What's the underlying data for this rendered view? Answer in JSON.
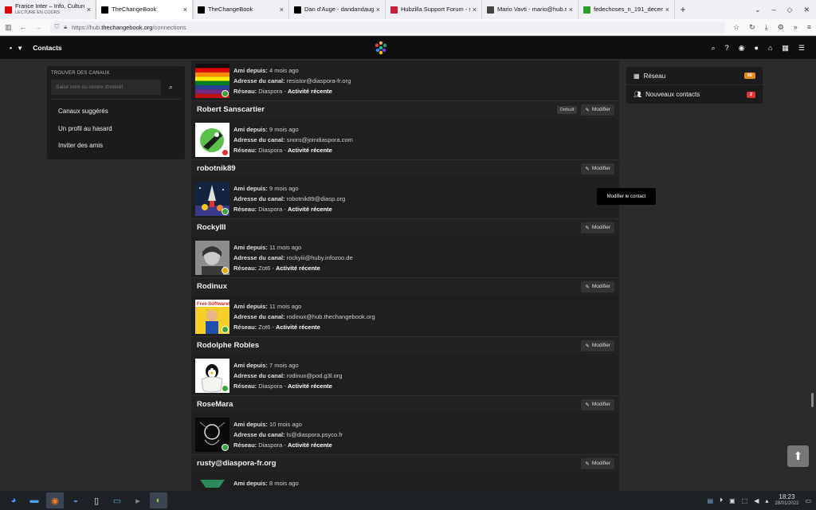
{
  "browser": {
    "tabs": [
      {
        "title": "France Inter – Info, Culture, Humour",
        "subtitle": "LECTURE EN COURS",
        "favicon_color": "#e20000",
        "active": false
      },
      {
        "title": "TheChangeBook",
        "subtitle": "",
        "favicon_color": "#000000",
        "active": true
      },
      {
        "title": "TheChangeBook",
        "subtitle": "",
        "favicon_color": "#000000",
        "active": false
      },
      {
        "title": "Dan d'Auge - dandandauge@",
        "subtitle": "",
        "favicon_color": "#000000",
        "active": false
      },
      {
        "title": "Hubzilla Support Forum - su",
        "subtitle": "",
        "favicon_color": "#c41e3a",
        "active": false
      },
      {
        "title": "Mario Vavti - mario@hub.sc",
        "subtitle": "",
        "favicon_color": "#444444",
        "active": false
      },
      {
        "title": "fedechoses_n_191_decembr",
        "subtitle": "",
        "favicon_color": "#2a9d2a",
        "active": false
      }
    ],
    "new_tab": "+",
    "url_scheme": "https://hub.",
    "url_host": "thechangebook.org",
    "url_path": "/connections"
  },
  "header": {
    "page_title": "Contacts"
  },
  "left_widget": {
    "title": "TROUVER DES CANAUX",
    "search_placeholder": "Saisir nom ou centre d'intérêt",
    "items": [
      "Canaux suggérés",
      "Un profil au hasard",
      "Inviter des amis"
    ]
  },
  "labels": {
    "since": "Ami depuis:",
    "address": "Adresse du canal:",
    "network": "Réseau:",
    "activity": "Activité récente",
    "edit": "Modifier",
    "default_tag": "Default"
  },
  "contacts": [
    {
      "name": "",
      "since": "4 mois ago",
      "address": "resistor@diaspora-fr.org",
      "network": "Diaspora",
      "status": "g",
      "default": false,
      "avatar": "rainbow"
    },
    {
      "name": "Robert Sanscartier",
      "since": "9 mois ago",
      "address": "snoro@joindiaspora.com",
      "network": "Diaspora",
      "status": "r",
      "default": true,
      "avatar": "green"
    },
    {
      "name": "robotnik89",
      "since": "9 mois ago",
      "address": "robotnik89@diasp.org",
      "network": "Diaspora",
      "status": "g",
      "default": false,
      "avatar": "space"
    },
    {
      "name": "RockyIII",
      "since": "11 mois ago",
      "address": "rockyiii@huby.infozoo.de",
      "network": "Zot6",
      "status": "y",
      "default": false,
      "avatar": "photo"
    },
    {
      "name": "Rodinux",
      "since": "11 mois ago",
      "address": "rodinux@hub.thechangebook.org",
      "network": "Zot6",
      "status": "g",
      "default": false,
      "avatar": "freesw"
    },
    {
      "name": "Rodolphe Robles",
      "since": "7 mois ago",
      "address": "rodinux@pod.g3l.org",
      "network": "Diaspora",
      "status": "g",
      "default": false,
      "avatar": "tux"
    },
    {
      "name": "RoseMara",
      "since": "10 mois ago",
      "address": "ls@diaspora.psyco.fr",
      "network": "Diaspora",
      "status": "g",
      "default": false,
      "avatar": "dark"
    },
    {
      "name": "rusty@diaspora-fr.org",
      "since": "8 mois ago",
      "address": "",
      "network": "",
      "status": "g",
      "default": false,
      "avatar": "teal"
    }
  ],
  "tooltip": "Modifier le contact",
  "right_widget": {
    "items": [
      {
        "label": "Réseau",
        "badge": "66",
        "badge_color": "#e8891c",
        "icon": "grid-icon"
      },
      {
        "label": "Nouveaux contacts",
        "badge": "2",
        "badge_color": "#d9353b",
        "icon": "users-icon"
      }
    ]
  },
  "taskbar": {
    "time": "18:23",
    "date": "28/01/2022"
  },
  "colors": {
    "background": "#2b2b2b",
    "panel": "#1f1f1f",
    "online": "#3aa33a",
    "offline": "#dd3333",
    "away": "#e8a516"
  }
}
